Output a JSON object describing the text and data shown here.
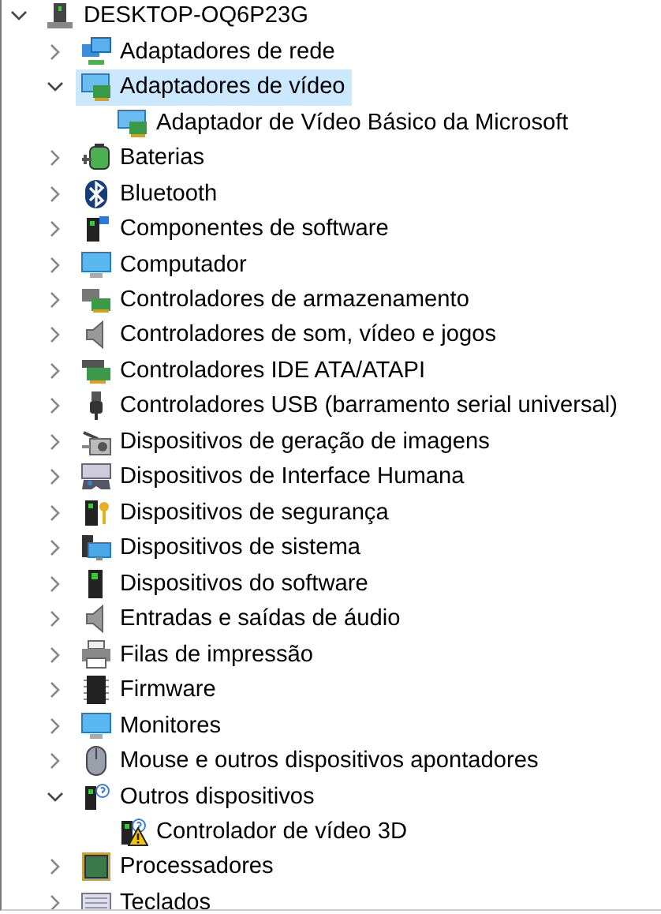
{
  "tree": {
    "label": "DESKTOP-OQ6P23G",
    "kind": "computer",
    "expanded": true,
    "selected": false,
    "children": [
      {
        "label": "Adaptadores de rede",
        "kind": "network",
        "expanded": false,
        "selected": false
      },
      {
        "label": "Adaptadores de vídeo",
        "kind": "display",
        "expanded": true,
        "selected": true,
        "children": [
          {
            "label": "Adaptador de Vídeo Básico da Microsoft",
            "kind": "display",
            "selected": false
          }
        ]
      },
      {
        "label": "Baterias",
        "kind": "battery",
        "expanded": false,
        "selected": false
      },
      {
        "label": "Bluetooth",
        "kind": "bluetooth",
        "expanded": false,
        "selected": false
      },
      {
        "label": "Componentes de software",
        "kind": "component",
        "expanded": false,
        "selected": false
      },
      {
        "label": "Computador",
        "kind": "monitor",
        "expanded": false,
        "selected": false
      },
      {
        "label": "Controladores de armazenamento",
        "kind": "storage",
        "expanded": false,
        "selected": false
      },
      {
        "label": "Controladores de som, vídeo e jogos",
        "kind": "speaker",
        "expanded": false,
        "selected": false
      },
      {
        "label": "Controladores IDE ATA/ATAPI",
        "kind": "card",
        "expanded": false,
        "selected": false
      },
      {
        "label": "Controladores USB (barramento serial universal)",
        "kind": "usb",
        "expanded": false,
        "selected": false
      },
      {
        "label": "Dispositivos de geração de imagens",
        "kind": "camera",
        "expanded": false,
        "selected": false
      },
      {
        "label": "Dispositivos de Interface Humana",
        "kind": "hid",
        "expanded": false,
        "selected": false
      },
      {
        "label": "Dispositivos de segurança",
        "kind": "security",
        "expanded": false,
        "selected": false
      },
      {
        "label": "Dispositivos de sistema",
        "kind": "system",
        "expanded": false,
        "selected": false
      },
      {
        "label": "Dispositivos do software",
        "kind": "tower",
        "expanded": false,
        "selected": false
      },
      {
        "label": "Entradas e saídas de áudio",
        "kind": "speaker",
        "expanded": false,
        "selected": false
      },
      {
        "label": "Filas de impressão",
        "kind": "printer",
        "expanded": false,
        "selected": false
      },
      {
        "label": "Firmware",
        "kind": "chip",
        "expanded": false,
        "selected": false
      },
      {
        "label": "Monitores",
        "kind": "monitor",
        "expanded": false,
        "selected": false
      },
      {
        "label": "Mouse e outros dispositivos apontadores",
        "kind": "mouse",
        "expanded": false,
        "selected": false
      },
      {
        "label": "Outros dispositivos",
        "kind": "unknown",
        "expanded": true,
        "selected": false,
        "children": [
          {
            "label": "Controlador de vídeo 3D",
            "kind": "unknown",
            "selected": false,
            "warning": true
          }
        ]
      },
      {
        "label": "Processadores",
        "kind": "processor",
        "expanded": false,
        "selected": false
      },
      {
        "label": "Teclados",
        "kind": "keyboard",
        "expanded": false,
        "selected": false
      }
    ]
  }
}
